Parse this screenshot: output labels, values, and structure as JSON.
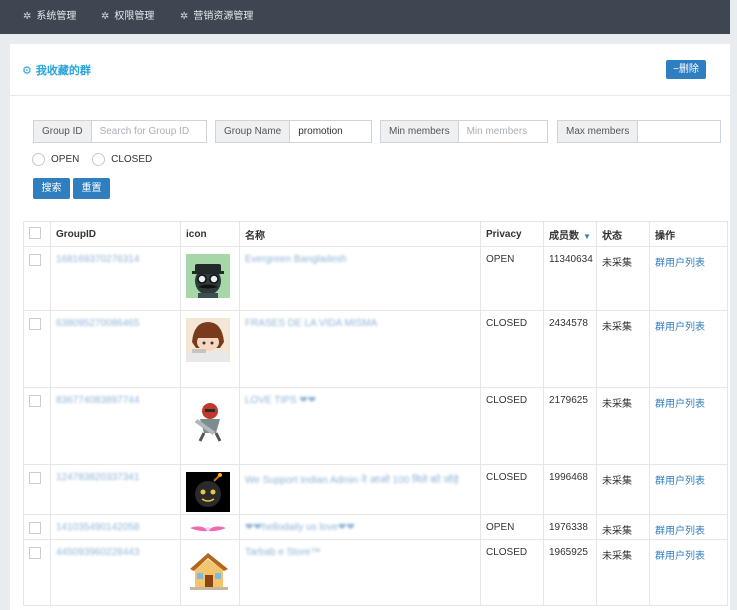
{
  "nav": {
    "items": [
      {
        "label": "系统管理",
        "icon": "gear-icon"
      },
      {
        "label": "权限管理",
        "icon": "gear-icon"
      },
      {
        "label": "营销资源管理",
        "icon": "gear-icon"
      }
    ]
  },
  "panel": {
    "title": "我收藏的群",
    "delete_label": "删除"
  },
  "filters": {
    "group_id": {
      "label": "Group ID",
      "placeholder": "Search for Group ID",
      "value": ""
    },
    "group_name": {
      "label": "Group Name",
      "value": "promotion"
    },
    "min_members": {
      "label": "Min members",
      "placeholder": "Min members",
      "value": ""
    },
    "max_members": {
      "label": "Max members",
      "value": ""
    },
    "privacy": {
      "open_label": "OPEN",
      "closed_label": "CLOSED"
    },
    "search_label": "搜索",
    "reset_label": "重置"
  },
  "table": {
    "headers": {
      "groupid": "GroupID",
      "icon": "icon",
      "name": "名称",
      "privacy": "Privacy",
      "members": "成员数",
      "status": "状态",
      "action": "操作"
    },
    "rows": [
      {
        "groupid": "168169370276314",
        "name": "Evergreen Bangladesh",
        "privacy": "OPEN",
        "members": "11340634",
        "status": "未采集",
        "action": "群用户列表",
        "icon": "mustache-avatar-icon"
      },
      {
        "groupid": "638095270086465",
        "name": "FRASES DE LA VIDA MISMA",
        "privacy": "CLOSED",
        "members": "2434578",
        "status": "未采集",
        "action": "群用户列表",
        "icon": "anime-girl-icon"
      },
      {
        "groupid": "836774083897744",
        "name": "LOVE TIPS ❤❤",
        "privacy": "CLOSED",
        "members": "2179625",
        "status": "未采集",
        "action": "群用户列表",
        "icon": "robot-figure-icon"
      },
      {
        "groupid": "124783820337341",
        "name": "We Support Indian Admin ने आओ 100 मिले को जोड़े",
        "privacy": "CLOSED",
        "members": "1996468",
        "status": "未采集",
        "action": "群用户列表",
        "icon": "black-bomb-icon"
      },
      {
        "groupid": "141035490142058",
        "name": "❤❤hellodaily us love❤❤",
        "privacy": "OPEN",
        "members": "1976338",
        "status": "未采集",
        "action": "群用户列表",
        "icon": "pink-flower-icon"
      },
      {
        "groupid": "445093960228443",
        "name": "Tarbab e Store™",
        "privacy": "CLOSED",
        "members": "1965925",
        "status": "未采集",
        "action": "群用户列表",
        "icon": "house-icon"
      }
    ]
  }
}
